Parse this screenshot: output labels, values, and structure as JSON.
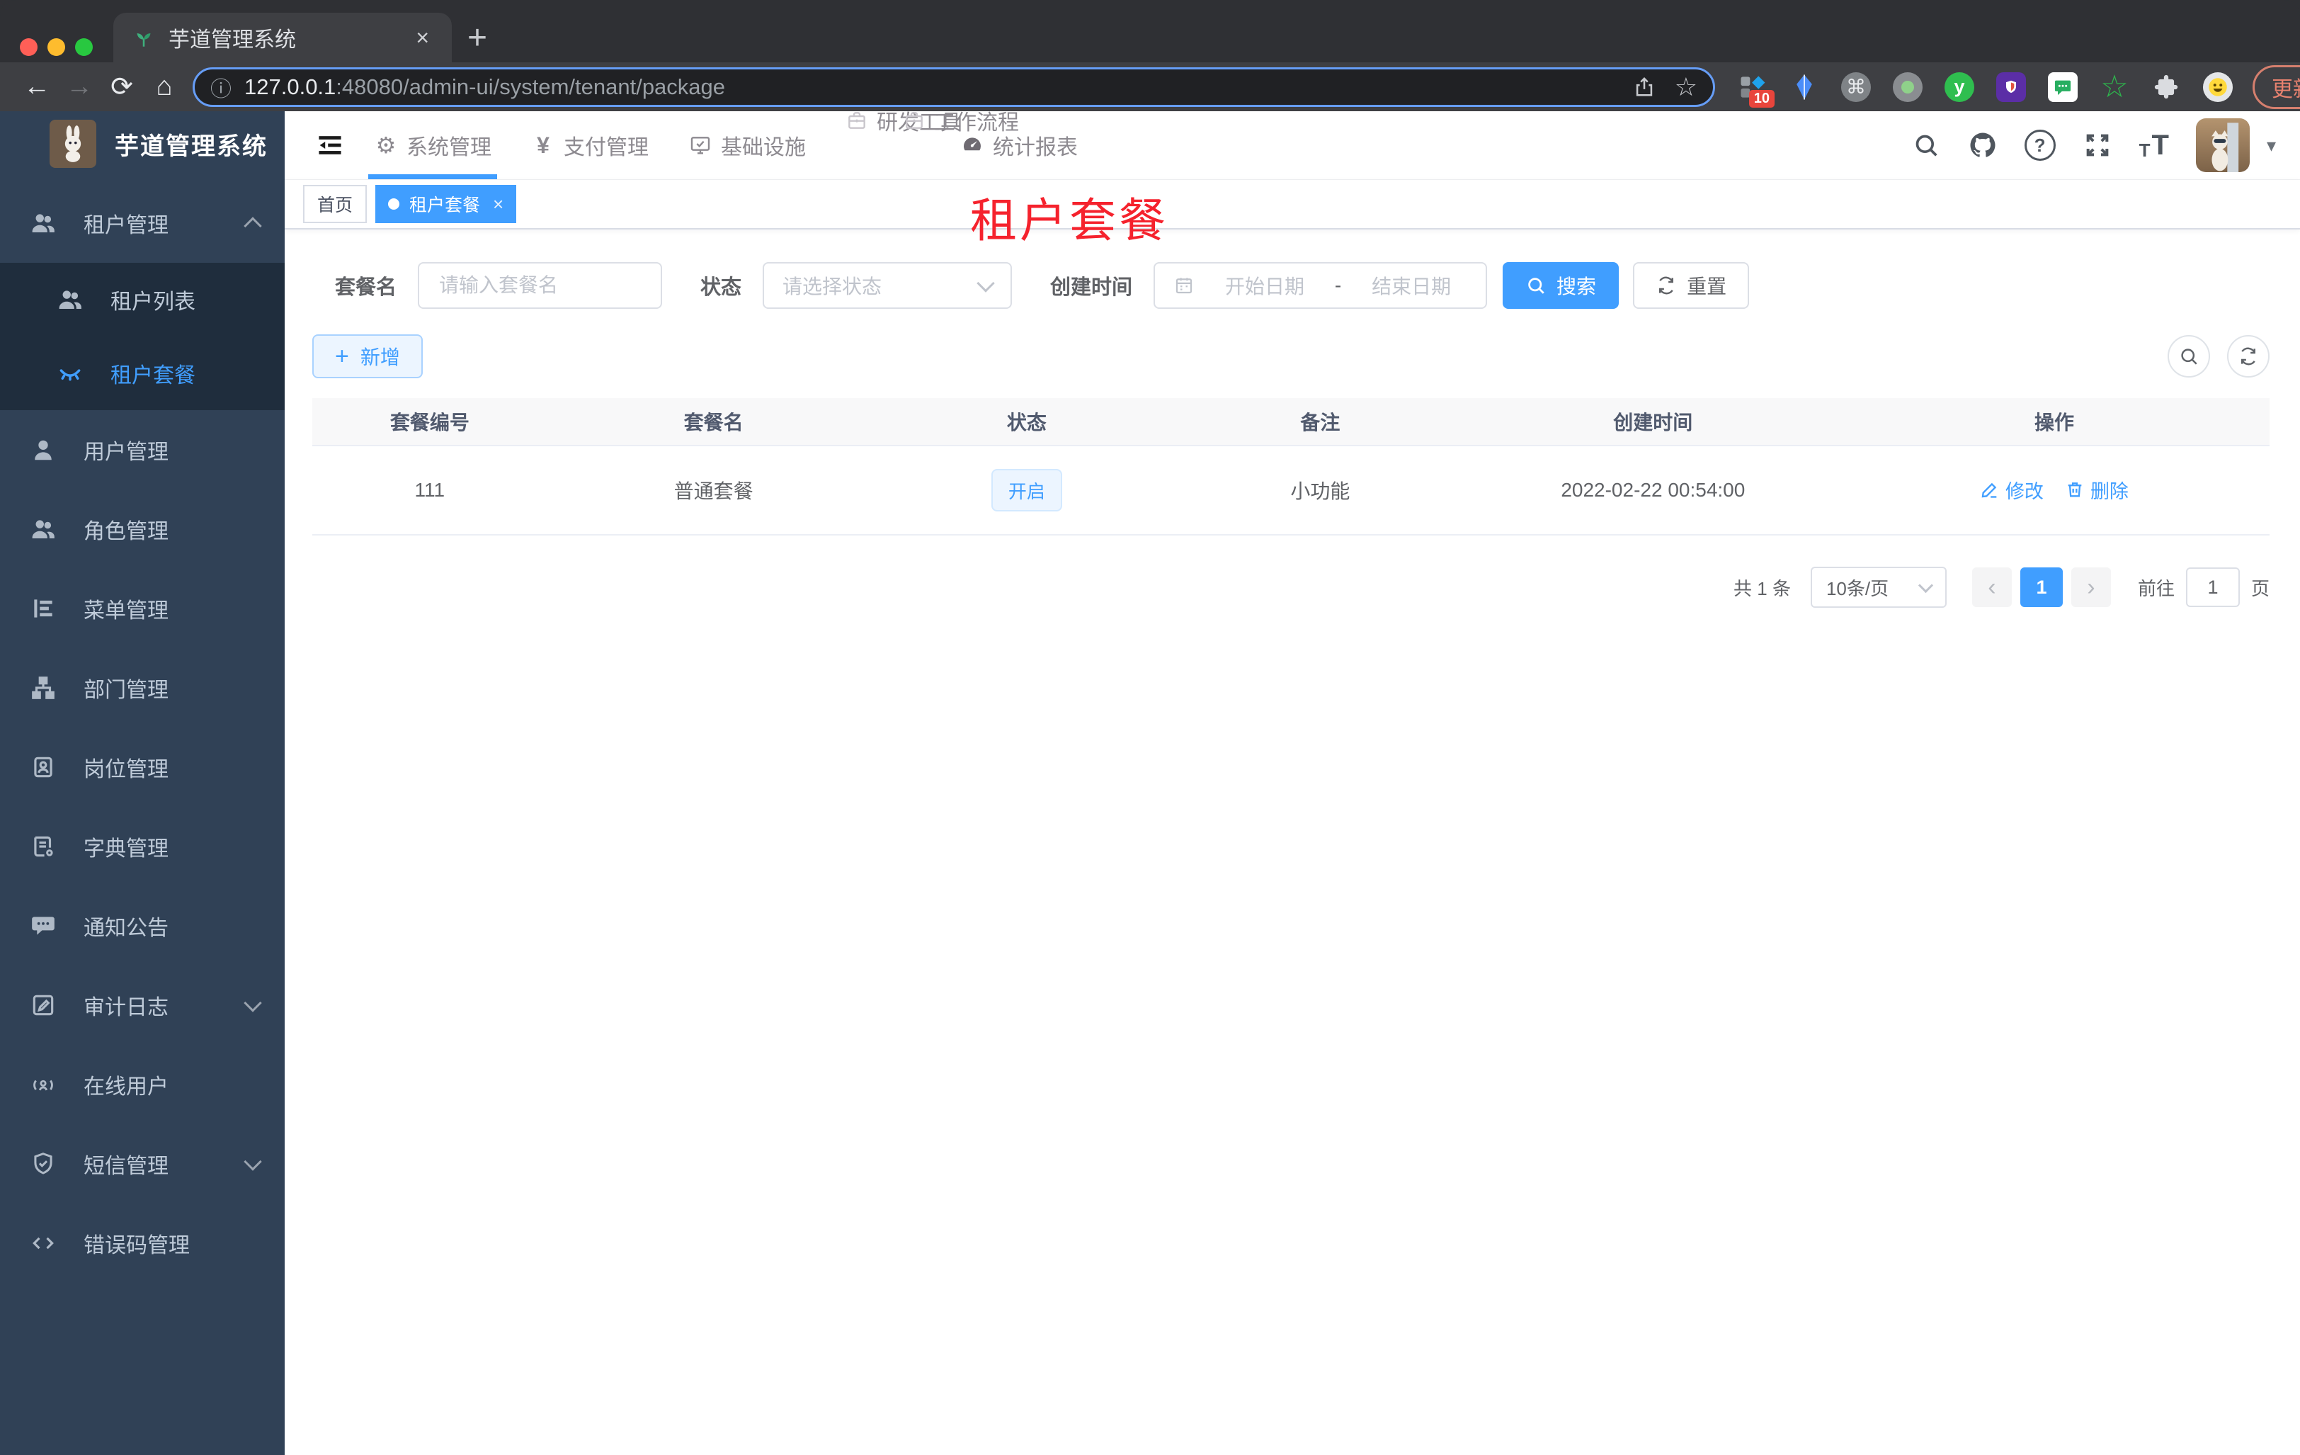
{
  "browser": {
    "tab_title": "芋道管理系统",
    "url_host": "127.0.0.1",
    "url_path": ":48080/admin-ui/system/tenant/package",
    "extension_badge": "10",
    "update_label": "更新"
  },
  "icons": {
    "back": "←",
    "forward": "→",
    "reload": "⟳",
    "home": "⌂",
    "info": "ⓘ",
    "star_outline": "☆",
    "plus": "+",
    "close": "×",
    "dot": "●",
    "ellipsis": "⋮",
    "caret_down": "▾",
    "command": "⌘",
    "ext_y": "y",
    "gear": "⚙",
    "yen": "¥",
    "question": "?",
    "font_t_small": "T",
    "font_t_large": "T",
    "chevron_left": "‹",
    "chevron_right": "›",
    "star_green": "☆"
  },
  "app": {
    "brand": "芋道管理系统",
    "watermark": "租户套餐",
    "top_nav": [
      {
        "label": "系统管理"
      },
      {
        "label": "支付管理"
      },
      {
        "label": "基础设施"
      },
      {
        "label": "研发工具"
      },
      {
        "label": "工作流程"
      },
      {
        "label": "统计报表"
      }
    ],
    "sidebar": {
      "items": [
        {
          "label": "租户管理",
          "children": [
            {
              "label": "租户列表"
            },
            {
              "label": "租户套餐"
            }
          ]
        },
        {
          "label": "用户管理"
        },
        {
          "label": "角色管理"
        },
        {
          "label": "菜单管理"
        },
        {
          "label": "部门管理"
        },
        {
          "label": "岗位管理"
        },
        {
          "label": "字典管理"
        },
        {
          "label": "通知公告"
        },
        {
          "label": "审计日志"
        },
        {
          "label": "在线用户"
        },
        {
          "label": "短信管理"
        },
        {
          "label": "错误码管理"
        }
      ]
    },
    "tags": {
      "home": "首页",
      "active": "租户套餐"
    },
    "filters": {
      "name_label": "套餐名",
      "name_placeholder": "请输入套餐名",
      "status_label": "状态",
      "status_placeholder": "请选择状态",
      "date_label": "创建时间",
      "date_start_placeholder": "开始日期",
      "date_separator": "-",
      "date_end_placeholder": "结束日期",
      "search_label": "搜索",
      "reset_label": "重置"
    },
    "toolbar": {
      "add_label": "新增"
    },
    "table": {
      "headers": [
        "套餐编号",
        "套餐名",
        "状态",
        "备注",
        "创建时间",
        "操作"
      ],
      "rows": [
        {
          "id": "111",
          "name": "普通套餐",
          "status": "开启",
          "remark": "小功能",
          "created_at": "2022-02-22 00:54:00",
          "edit_label": "修改",
          "delete_label": "删除"
        }
      ]
    },
    "pagination": {
      "total": "共 1 条",
      "page_size": "10条/页",
      "page": "1",
      "goto_label": "前往",
      "goto_value": "1",
      "unit_label": "页"
    },
    "colors": {
      "accent": "#409eff",
      "sidebar_bg": "#304156",
      "submenu_bg": "#1f2d3d",
      "tag_bg": "#ecf5ff",
      "watermark_red": "#f5222d"
    }
  }
}
